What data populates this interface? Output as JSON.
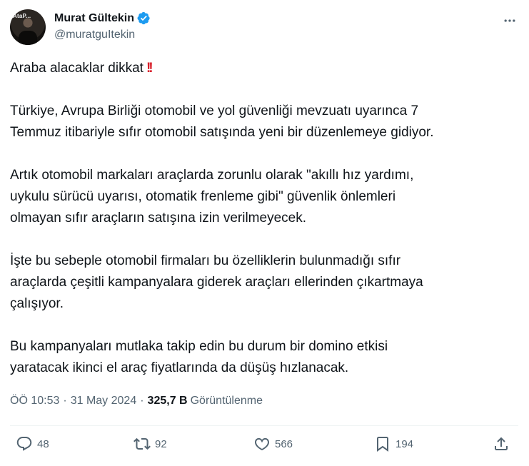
{
  "author": {
    "name": "Murat Gültekin",
    "handle": "@muratguItekin",
    "avatar_text": "AtaP..."
  },
  "tweet": {
    "paragraphs": [
      "Türkiye, Avrupa Birliği otomobil ve yol güvenliği mevzuatı uyarınca 7\nTemmuz itibariyle sıfır otomobil satışında yeni bir düzenlemeye gidiyor.",
      "Artık otomobil markaları araçlarda zorunlu olarak \"akıllı hız yardımı,\nuykulu sürücü uyarısı, otomatik frenleme gibi\" güvenlik önlemleri\nolmayan sıfır araçların  satışına izin verilmeyecek.",
      "İşte bu sebeple otomobil firmaları bu özelliklerin bulunmadığı sıfır\naraçlarda çeşitli kampanyalara giderek araçları ellerinden çıkartmaya\nçalışıyor.",
      "Bu kampanyaları mutlaka takip edin bu durum bir domino etkisi\nyaratacak ikinci el araç fiyatlarında da düşüş hızlanacak."
    ],
    "first_line": "Araba alacaklar dikkat",
    "first_line_emoji": "!!"
  },
  "meta": {
    "time": "ÖÖ 10:53",
    "date": "31 May 2024",
    "views": "325,7 B",
    "views_label": "Görüntülenme",
    "sep": "·"
  },
  "actions": {
    "replies": "48",
    "retweets": "92",
    "likes": "566",
    "bookmarks": "194"
  },
  "colors": {
    "text": "#0f1419",
    "secondary": "#536471",
    "verified": "#1d9bf0",
    "emoji_red": "#d81e2a"
  }
}
